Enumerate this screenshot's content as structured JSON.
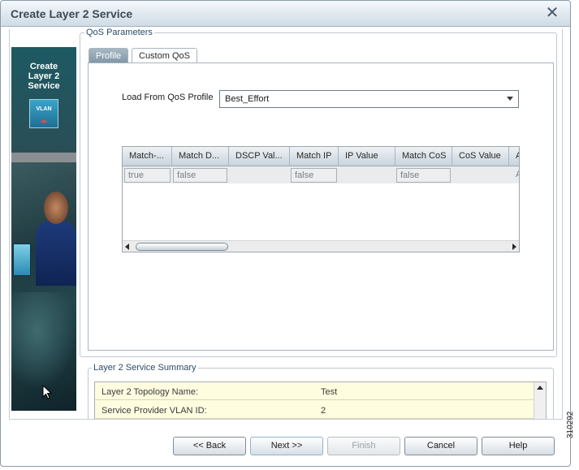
{
  "window": {
    "title": "Create Layer 2 Service"
  },
  "banner": {
    "title": "Create\nLayer 2\nService",
    "icon_text": "VLAN",
    "icon": "vlan-icon"
  },
  "qos": {
    "legend": "QoS Parameters",
    "tabs": [
      {
        "label": "Profile",
        "selected": true
      },
      {
        "label": "Custom QoS",
        "selected": false
      }
    ],
    "load_label": "Load From QoS Profile",
    "profile_value": "Best_Effort"
  },
  "grid": {
    "columns": [
      "Match-...",
      "Match D...",
      "DSCP Val...",
      "Match IP",
      "IP Value",
      "Match CoS",
      "CoS Value",
      "A"
    ],
    "row": [
      "true",
      "false",
      "",
      "false",
      "",
      "false",
      "",
      "A"
    ]
  },
  "summary": {
    "legend": "Layer 2 Service Summary",
    "rows": [
      {
        "key": "Layer 2 Topology Name:",
        "value": "Test"
      },
      {
        "key": "Service Provider VLAN ID:",
        "value": "2"
      }
    ]
  },
  "buttons": {
    "back": "<< Back",
    "next": "Next >>",
    "finish": "Finish",
    "cancel": "Cancel",
    "help": "Help"
  },
  "figure_id": "310292",
  "colors": {
    "banner": "#2d4f57",
    "summary_bg": "#fffde0",
    "tab_selected": "#8a9fae"
  }
}
